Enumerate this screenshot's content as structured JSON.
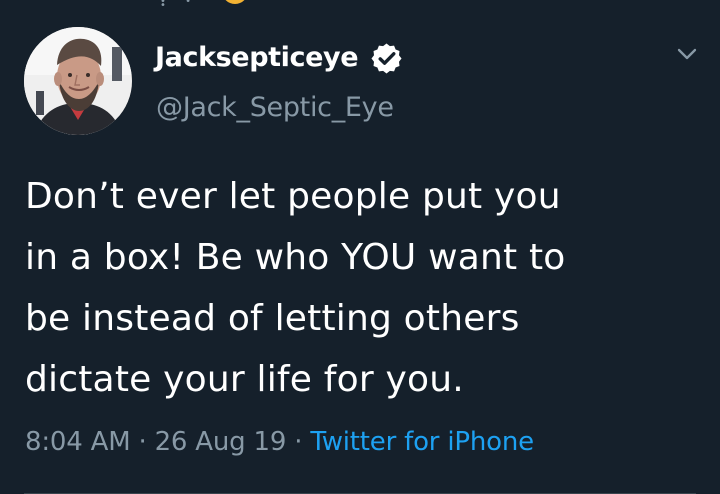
{
  "tweet": {
    "display_name": "Jacksepticeye",
    "handle": "@Jack_Septic_Eye",
    "lines": [
      "Don’t ever let people put you",
      "in a box! Be who YOU want to",
      "be instead of letting others",
      "dictate your life for you."
    ],
    "time": "8:04 AM",
    "date": "26 Aug 19",
    "source": "Twitter for iPhone",
    "separator": "·"
  },
  "icons": {
    "verified": "verified-badge-icon",
    "menu": "chevron-down-icon"
  },
  "colors": {
    "background": "#15202b",
    "primary_text": "#ffffff",
    "secondary_text": "#8899a6",
    "link": "#1da1f2",
    "divider": "#38444d"
  }
}
